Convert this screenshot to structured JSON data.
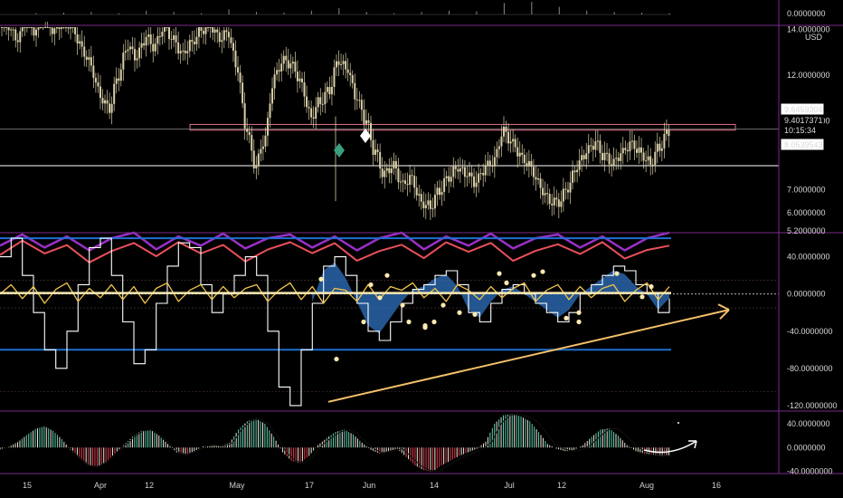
{
  "colors": {
    "background": "#000000",
    "divider": "#7a2a8a",
    "axis_text": "#d8d8d8",
    "candle": "#d9cfa8",
    "horizontal_ref": "#ffffff",
    "zone": "#e0708a",
    "white_line": "#ffffff",
    "yellow_line": "#f3c64a",
    "red_line": "#e8505a",
    "purple_line": "#9a30c8",
    "blue_level": "#1e6fd0",
    "blue_fill": "#2f72c0",
    "pink_fill": "#c06080",
    "trend_arrow": "#f3c06a",
    "hist_green": "#5fd0b0",
    "hist_red": "#e04050",
    "hist_white": "#f0e8d8",
    "diamond_white": "#ffffff",
    "diamond_teal": "#3aa080"
  },
  "chart_data": [
    {
      "type": "bar",
      "panel": "volume",
      "ylim": [
        0,
        1
      ],
      "y_ticks": [
        "0.0000000"
      ],
      "values_note_free": true,
      "series": [
        {
          "values": [
            0.1,
            0.15,
            0.2,
            0.1,
            0.3,
            0.2,
            0.1,
            0.4,
            0.2,
            0.15,
            0.3,
            0.5,
            0.2,
            0.1,
            0.2,
            0.3,
            0.25,
            0.9,
            1,
            0.6,
            0.3,
            0.2,
            0.15,
            0.1
          ]
        }
      ]
    },
    {
      "type": "line",
      "panel": "price",
      "y_unit": "USD",
      "ylim": [
        5.2,
        14.0
      ],
      "y_ticks": [
        "14.0000000",
        "12.0000000",
        "10.0000000",
        "7.0000000",
        "6.0000000",
        "5.2000000"
      ],
      "x_ticks": [
        "15",
        "Apr",
        "12",
        "May",
        "17",
        "Jun",
        "14",
        "Jul",
        "12",
        "Aug",
        "16"
      ],
      "price_labels": [
        "9.6459304",
        "9.4017371",
        "10:15:34",
        "8.0539543"
      ],
      "horizontal_lines": [
        9.65,
        8.05
      ],
      "zone": [
        9.6,
        9.85
      ],
      "close": [
        14.2,
        13.6,
        14.5,
        13.9,
        14.8,
        13.8,
        14.4,
        14.1,
        13.2,
        12.5,
        11.2,
        10.6,
        12.0,
        13.3,
        12.8,
        13.6,
        13.2,
        14.1,
        13.5,
        12.9,
        13.4,
        14.0,
        14.3,
        13.7,
        13.9,
        12.3,
        9.6,
        8.0,
        9.2,
        11.8,
        12.6,
        12.4,
        11.6,
        10.2,
        10.9,
        11.4,
        12.7,
        12.3,
        11.0,
        10.0,
        8.6,
        7.6,
        8.0,
        7.2,
        7.5,
        6.5,
        6.3,
        7.0,
        7.6,
        8.0,
        7.7,
        7.3,
        7.9,
        8.2,
        9.5,
        9.0,
        8.4,
        8.0,
        7.2,
        6.6,
        6.5,
        7.1,
        8.0,
        8.6,
        9.0,
        8.4,
        8.1,
        8.6,
        9.0,
        8.6,
        8.2,
        8.9,
        9.6
      ]
    },
    {
      "type": "line",
      "panel": "oscillator",
      "ylim": [
        -120,
        60
      ],
      "y_ticks": [
        "40.0000000",
        "0.0000000",
        "-40.0000000",
        "-80.0000000",
        "-120.0000000"
      ],
      "levels": [
        60,
        -60
      ],
      "series": [
        {
          "values": [
            40,
            60,
            20,
            -20,
            -60,
            -80,
            -40,
            10,
            50,
            60,
            20,
            -30,
            -75,
            -60,
            -10,
            30,
            55,
            50,
            10,
            -20,
            0,
            20,
            40,
            20,
            -40,
            -100,
            -120,
            -60,
            -10,
            30,
            40,
            20,
            -10,
            -40,
            -50,
            -30,
            -10,
            5,
            10,
            20,
            25,
            10,
            -20,
            -30,
            -10,
            5,
            10,
            0,
            -10,
            -20,
            -30,
            -20,
            0,
            10,
            20,
            30,
            25,
            10,
            0,
            -20,
            -5
          ]
        },
        {
          "values": [
            0,
            10,
            -5,
            8,
            -10,
            5,
            12,
            -8,
            6,
            -4,
            10,
            -6,
            8,
            -10,
            6,
            12,
            -8,
            4,
            10,
            -6,
            8,
            -4,
            6,
            10,
            -8,
            4,
            12,
            -6,
            8,
            -10,
            6,
            4,
            -8,
            10,
            -6,
            8,
            4,
            12,
            -4,
            6,
            -8,
            10,
            4,
            -6,
            8,
            -4,
            6,
            12,
            -8,
            4,
            10,
            -6,
            8,
            -4,
            6,
            10,
            -8,
            4,
            12,
            -6,
            8
          ]
        },
        {
          "values": [
            50,
            62,
            48,
            60,
            45,
            58,
            64,
            46,
            60,
            50,
            63,
            47,
            58,
            62,
            48,
            60,
            45,
            58,
            64,
            46,
            60,
            50,
            63,
            47,
            58,
            62,
            48,
            60,
            45,
            58,
            64
          ]
        }
      ]
    },
    {
      "type": "bar",
      "panel": "histogram",
      "ylim": [
        -40,
        45
      ],
      "y_ticks": [
        "40.0000000",
        "0.0000000",
        "-40.0000000"
      ],
      "values": [
        -4,
        2,
        10,
        22,
        32,
        36,
        28,
        14,
        -4,
        -18,
        -30,
        -32,
        -24,
        -10,
        4,
        18,
        28,
        30,
        20,
        6,
        -8,
        -12,
        -6,
        2,
        4,
        2,
        8,
        30,
        44,
        48,
        40,
        18,
        -8,
        -22,
        -26,
        -14,
        4,
        16,
        26,
        30,
        22,
        8,
        -4,
        -10,
        -6,
        -2,
        -16,
        -30,
        -38,
        -40,
        -30,
        -22,
        -14,
        -8,
        -2,
        10,
        40,
        54,
        56,
        52,
        44,
        26,
        6,
        -2,
        -6,
        -4,
        4,
        18,
        30,
        32,
        20,
        4,
        -6,
        -10,
        -12,
        -14
      ]
    }
  ]
}
